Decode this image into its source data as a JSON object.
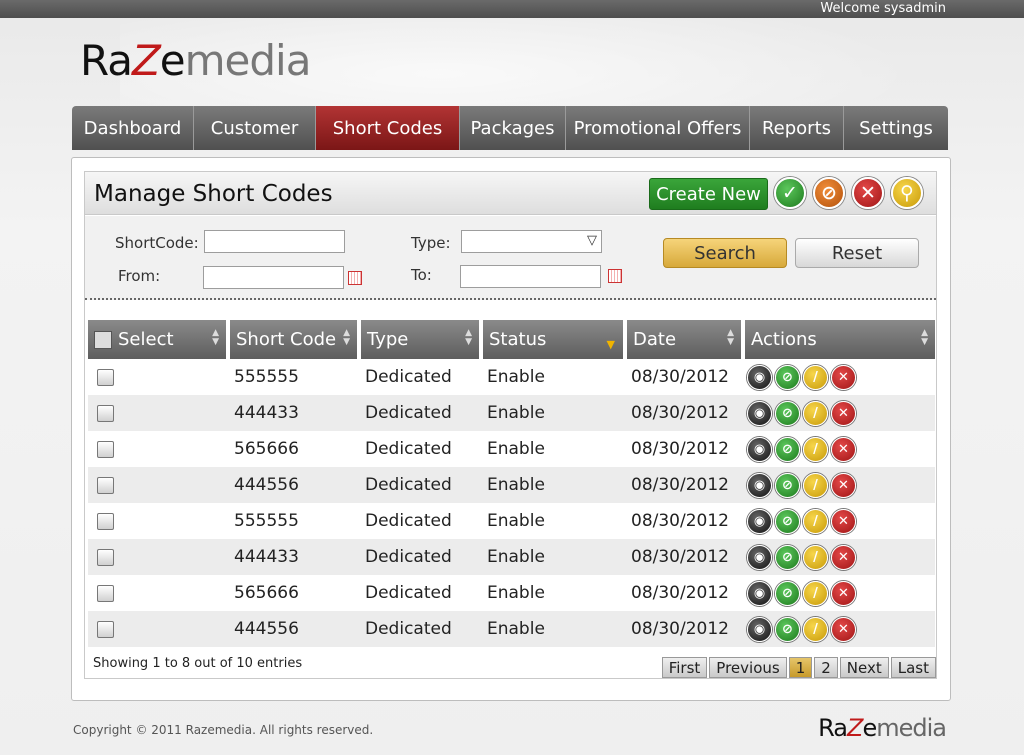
{
  "header": {
    "welcome": "Welcome sysadmin",
    "logo": {
      "part1": "Ra",
      "part2": "Z",
      "part3": "e",
      "part4": "media"
    }
  },
  "nav": [
    {
      "label": "Dashboard",
      "active": false
    },
    {
      "label": "Customer",
      "active": false
    },
    {
      "label": "Short Codes",
      "active": true
    },
    {
      "label": "Packages",
      "active": false
    },
    {
      "label": "Promotional Offers",
      "active": false
    },
    {
      "label": "Reports",
      "active": false
    },
    {
      "label": "Settings",
      "active": false
    }
  ],
  "panel": {
    "title": "Manage Short Codes",
    "create_label": "Create New",
    "icons": {
      "enable": "check-icon",
      "disable": "block-icon",
      "delete": "x-icon",
      "search": "search-icon"
    }
  },
  "filters": {
    "shortcode_label": "ShortCode:",
    "shortcode_value": "",
    "type_label": "Type:",
    "type_value": "",
    "from_label": "From:",
    "from_value": "",
    "to_label": "To:",
    "to_value": "",
    "search_label": "Search",
    "reset_label": "Reset"
  },
  "table": {
    "columns": [
      "Select",
      "Short Code",
      "Type",
      "Status",
      "Date",
      "Actions"
    ],
    "rows": [
      {
        "code": "555555",
        "type": "Dedicated",
        "status": "Enable",
        "date": "08/30/2012"
      },
      {
        "code": "444433",
        "type": "Dedicated",
        "status": "Enable",
        "date": "08/30/2012"
      },
      {
        "code": "565666",
        "type": "Dedicated",
        "status": "Enable",
        "date": "08/30/2012"
      },
      {
        "code": "444556",
        "type": "Dedicated",
        "status": "Enable",
        "date": "08/30/2012"
      },
      {
        "code": "555555",
        "type": "Dedicated",
        "status": "Enable",
        "date": "08/30/2012"
      },
      {
        "code": "444433",
        "type": "Dedicated",
        "status": "Enable",
        "date": "08/30/2012"
      },
      {
        "code": "565666",
        "type": "Dedicated",
        "status": "Enable",
        "date": "08/30/2012"
      },
      {
        "code": "444556",
        "type": "Dedicated",
        "status": "Enable",
        "date": "08/30/2012"
      }
    ]
  },
  "footer_info": {
    "showing": "Showing 1 to 8 out of 10 entries",
    "pager": [
      "First",
      "Previous",
      "1",
      "2",
      "Next",
      "Last"
    ],
    "current_page": "1"
  },
  "footer": {
    "copyright": "Copyright © 2011 Razemedia. All rights reserved."
  },
  "colors": {
    "accent_red": "#a02020",
    "nav_gray": "#5a5a5a",
    "create_green": "#2a8f2a",
    "search_gold": "#e2b74f"
  }
}
